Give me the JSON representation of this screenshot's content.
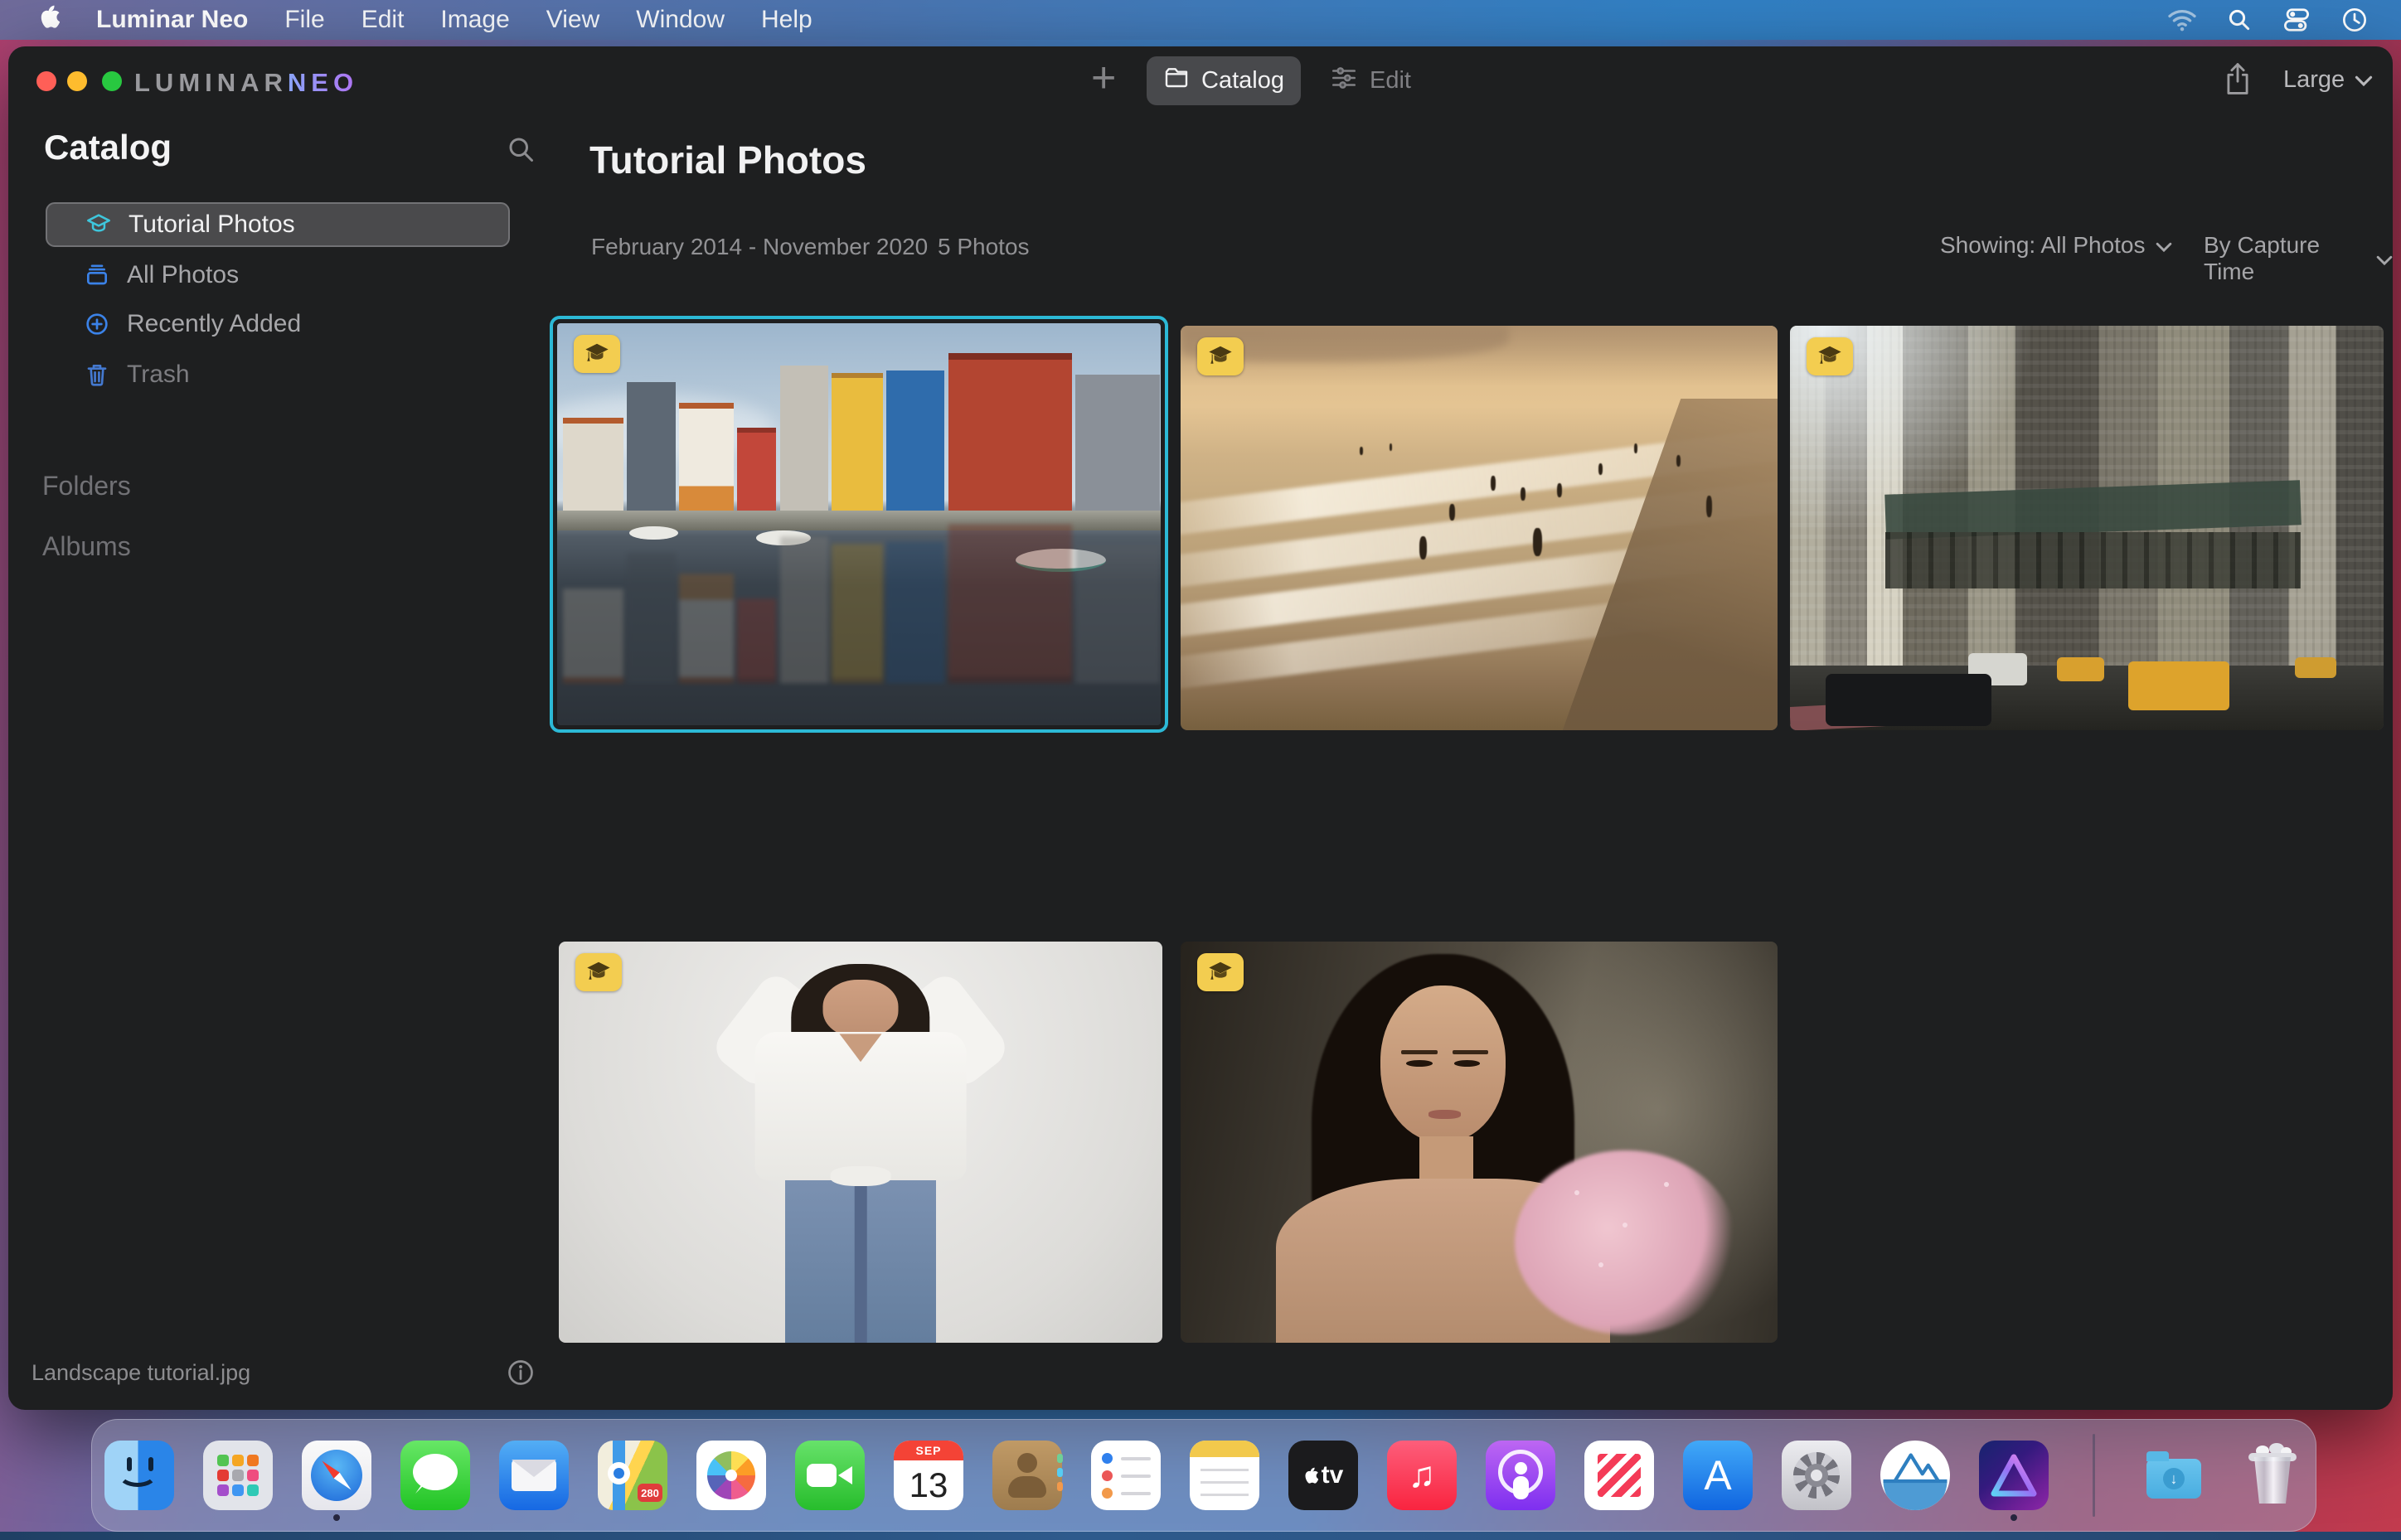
{
  "menu_bar": {
    "app_name": "Luminar Neo",
    "menus": [
      "File",
      "Edit",
      "Image",
      "View",
      "Window",
      "Help"
    ],
    "status_icons": [
      "wifi-icon",
      "search-icon",
      "control-center-icon",
      "clock-icon"
    ]
  },
  "window": {
    "logo_primary": "LUMINAR",
    "logo_accent": "NEO",
    "toolbar": {
      "add": "+",
      "catalog": "Catalog",
      "edit": "Edit",
      "thumbnail_size": "Large"
    },
    "sidebar": {
      "title": "Catalog",
      "items": [
        {
          "label": "Tutorial Photos",
          "icon": "graduation-cap-icon",
          "selected": true
        },
        {
          "label": "All Photos",
          "icon": "stacked-photos-icon",
          "selected": false
        },
        {
          "label": "Recently Added",
          "icon": "plus-circle-icon",
          "selected": false
        },
        {
          "label": "Trash",
          "icon": "trash-icon",
          "selected": false
        }
      ],
      "sections": [
        "Folders",
        "Albums"
      ],
      "footer_filename": "Landscape tutorial.jpg"
    },
    "content": {
      "title": "Tutorial Photos",
      "date_range": "February 2014 - November 2020",
      "photo_count": "5 Photos",
      "filter": "Showing: All Photos",
      "sort": "By Capture Time",
      "photos": [
        {
          "name": "colorful-canal-houses",
          "selected": true,
          "badge": "tutorial-graduation-badge"
        },
        {
          "name": "beach-sunset-swimmers",
          "selected": false,
          "badge": "tutorial-graduation-badge"
        },
        {
          "name": "city-street-taxis",
          "selected": false,
          "badge": "tutorial-graduation-badge"
        },
        {
          "name": "woman-in-white-blouse",
          "selected": false,
          "badge": "tutorial-graduation-badge"
        },
        {
          "name": "woman-portrait-pink-flower",
          "selected": false,
          "badge": "tutorial-graduation-badge"
        }
      ]
    },
    "colors": {
      "selection_accent": "#2cb9d6",
      "badge_bg": "#f3cd50",
      "neo_gradient_start": "#8aa4f8",
      "neo_gradient_end": "#b072f2",
      "sidebar_icon_active": "#3ec6dc",
      "sidebar_icon_blue": "#3b82e8"
    }
  },
  "dock": {
    "apps": [
      "Finder",
      "Launchpad",
      "Safari",
      "Messages",
      "Mail",
      "Maps",
      "Photos",
      "FaceTime",
      "Calendar",
      "Contacts",
      "Reminders",
      "Notes",
      "TV",
      "Music",
      "Podcasts",
      "News",
      "App Store",
      "System Settings",
      "Luminar Share",
      "Luminar Neo",
      "Downloads",
      "Trash"
    ],
    "running_apps": [
      "Finder",
      "Safari",
      "Luminar Neo"
    ],
    "calendar": {
      "month": "SEP",
      "day": "13"
    },
    "maps_badge": "280",
    "tv_label": "tv"
  }
}
